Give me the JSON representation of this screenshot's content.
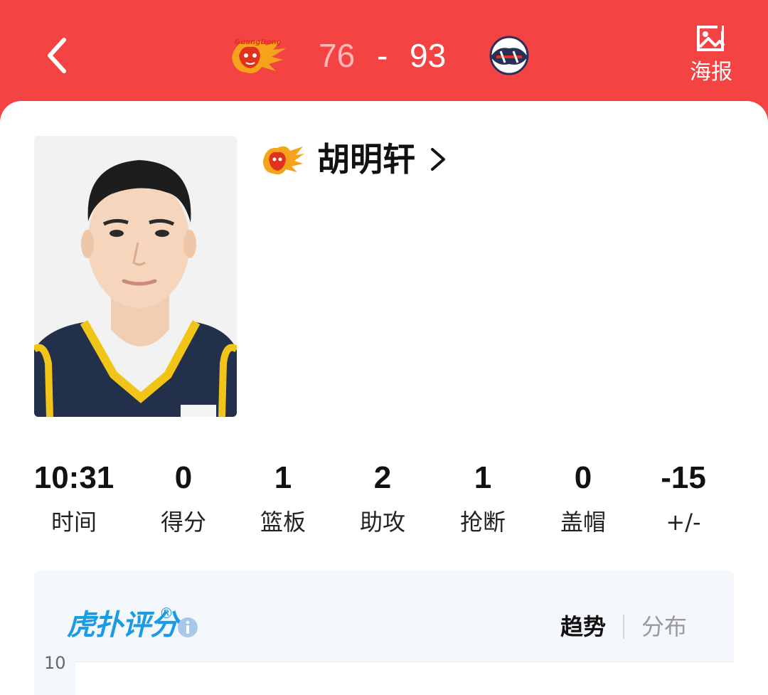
{
  "header": {
    "home_team_logo": "guangdong-tigers-logo",
    "away_team_logo": "liaoning-flying-leopards-logo",
    "home_score": "76",
    "dash": "-",
    "away_score": "93",
    "back_icon": "chevron-left-icon",
    "poster_icon": "image-icon",
    "poster_label": "海报",
    "colors": {
      "background": "#f44343",
      "home_score": "#ffb9b9",
      "away_score": "#ffffff"
    }
  },
  "player": {
    "name": "胡明轩",
    "team_logo": "guangdong-tigers-logo",
    "chevron_icon": "chevron-right-icon"
  },
  "stats": [
    {
      "value": "10:31",
      "label": "时间"
    },
    {
      "value": "0",
      "label": "得分"
    },
    {
      "value": "1",
      "label": "篮板"
    },
    {
      "value": "2",
      "label": "助攻"
    },
    {
      "value": "1",
      "label": "抢断"
    },
    {
      "value": "0",
      "label": "盖帽"
    },
    {
      "value": "-15",
      "label": "+/-"
    }
  ],
  "rating": {
    "logo_text": "虎扑评分",
    "logo_reg": "®",
    "info_icon": "info-icon",
    "tabs": [
      {
        "label": "趋势",
        "active": true
      },
      {
        "label": "分布",
        "active": false
      }
    ],
    "y_tick": "10",
    "accent": "#1a9be6"
  }
}
